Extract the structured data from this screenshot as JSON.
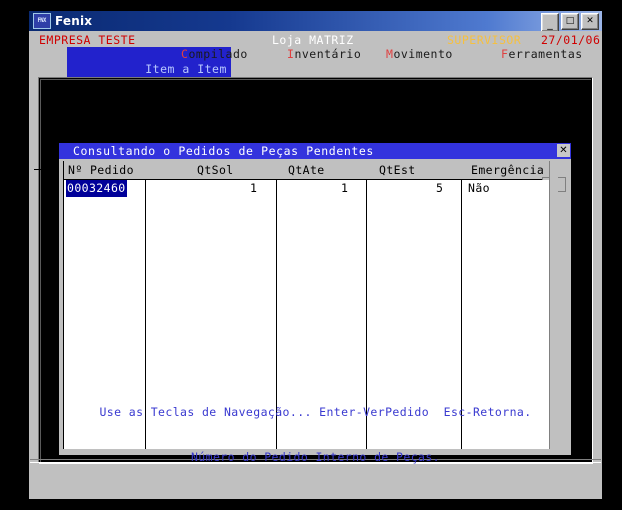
{
  "window": {
    "title": "Fenix",
    "icon": "fenix-logo-icon",
    "buttons": {
      "minimize": "_",
      "maximize": "□",
      "close": "✕"
    }
  },
  "header": {
    "company": "EMPRESA TESTE",
    "store": "Loja MATRIZ",
    "user": "SUPERVISOR",
    "date": "27/01/06"
  },
  "menu": {
    "items": [
      {
        "label": "Item a Item",
        "hotkey": "I",
        "selected": true
      },
      {
        "label": "Compilado",
        "hotkey": "C",
        "selected": false
      },
      {
        "label": "Inventário",
        "hotkey": "I",
        "selected": false
      },
      {
        "label": "Movimento",
        "hotkey": "M",
        "selected": false
      },
      {
        "label": "Ferramentas",
        "hotkey": "F",
        "selected": false
      }
    ]
  },
  "dialog": {
    "title": "Consultando o Pedidos de Peças Pendentes",
    "close_label": "✕",
    "scroll_label": ">",
    "columns": [
      {
        "key": "pedido",
        "label": "Nº Pedido"
      },
      {
        "key": "qtsol",
        "label": "QtSol"
      },
      {
        "key": "qtate",
        "label": "QtAte"
      },
      {
        "key": "qtest",
        "label": "QtEst"
      },
      {
        "key": "emergencia",
        "label": "Emergência"
      }
    ],
    "rows": [
      {
        "pedido": "00032460",
        "qtsol": "1",
        "qtate": "1",
        "qtest": "5",
        "emergencia": "Não",
        "selected_cell": "pedido"
      }
    ]
  },
  "status": {
    "line1": "Use as Teclas de Navegação... Enter-VerPedido  Esc-Retorna.",
    "line2": "Número do Pedido Interno de Peças."
  },
  "colors": {
    "titlebar_start": "#0a2a72",
    "titlebar_end": "#9cb6e8",
    "dialog_title_bg": "#3333dd",
    "selection_bg": "#000099",
    "menu_selected_bg": "#2222cc",
    "company_red": "#d00000",
    "user_yellow": "#f5c040",
    "status_blue": "#3a3ad0",
    "face": "#c0c0c0"
  }
}
